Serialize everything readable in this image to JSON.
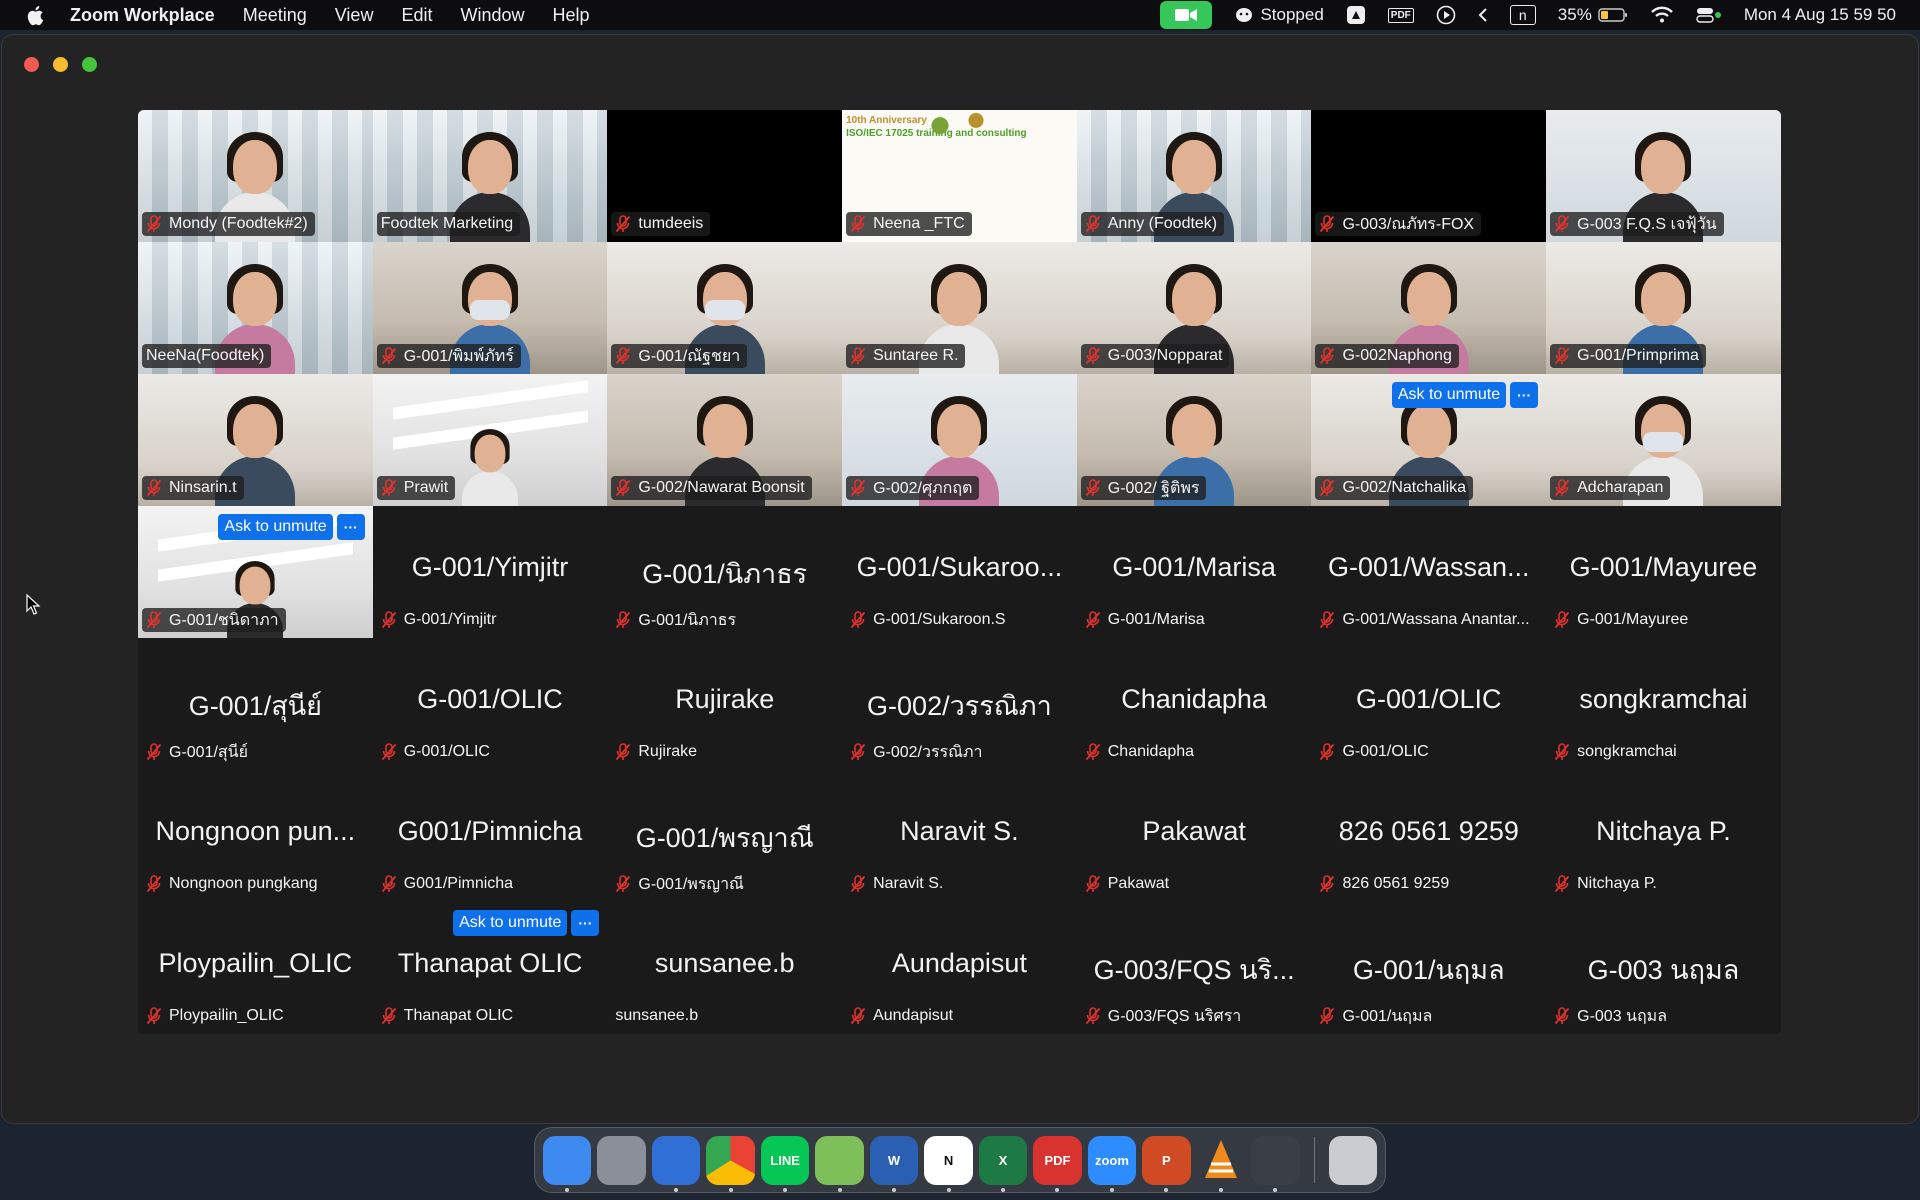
{
  "menubar": {
    "app_name": "Zoom Workplace",
    "items": [
      "Meeting",
      "View",
      "Edit",
      "Window",
      "Help"
    ],
    "status_text": "Stopped",
    "battery": "35%",
    "datetime": "Mon 4 Aug  15 59 50",
    "pdf_label": "PDF",
    "n_label": "n"
  },
  "gallery": {
    "ask_to_unmute_label": "Ask to unmute",
    "more_label": "···",
    "slide_text_1": "10th Anniversary",
    "slide_text_2": "ISO/IEC 17025 training and consulting",
    "tiles": [
      {
        "name": "Mondy (Foodtek#2)",
        "kind": "video",
        "scene": "office",
        "muted": true
      },
      {
        "name": "Foodtek Marketing",
        "kind": "video",
        "scene": "office",
        "muted": false,
        "speaking": true
      },
      {
        "name": "tumdeeis",
        "kind": "black",
        "muted": true
      },
      {
        "name": "Neena _FTC",
        "kind": "slide",
        "muted": true
      },
      {
        "name": "Anny (Foodtek)",
        "kind": "video",
        "scene": "office",
        "muted": true
      },
      {
        "name": "G-003/ณภัทร-FOX",
        "kind": "black",
        "muted": true
      },
      {
        "name": "G-003 F.Q.S เจฟุ้วัน",
        "kind": "video",
        "scene": "blue-bg",
        "muted": true
      },
      {
        "name": "NeeNa(Foodtek)",
        "kind": "video",
        "scene": "office",
        "muted": false
      },
      {
        "name": "G-001/พิมพ์ภัทร์",
        "kind": "video",
        "scene": "room",
        "muted": true,
        "mask": true
      },
      {
        "name": "G-001/ณัฐชยา",
        "kind": "video",
        "scene": "room2",
        "muted": true,
        "mask": true
      },
      {
        "name": "Suntaree R.",
        "kind": "video",
        "scene": "room2",
        "muted": true
      },
      {
        "name": "G-003/Nopparat",
        "kind": "video",
        "scene": "room2",
        "muted": true
      },
      {
        "name": "G-002Naphong",
        "kind": "video",
        "scene": "room",
        "muted": true
      },
      {
        "name": "G-001/Primprima",
        "kind": "video",
        "scene": "room2",
        "muted": true
      },
      {
        "name": "Ninsarin.t",
        "kind": "video",
        "scene": "room2",
        "muted": true
      },
      {
        "name": "Prawit",
        "kind": "video",
        "scene": "ceiling",
        "muted": true
      },
      {
        "name": "G-002/Nawarat Boonsit",
        "kind": "video",
        "scene": "room",
        "muted": true
      },
      {
        "name": "G-002/ศุภกฤต",
        "kind": "video",
        "scene": "blue-bg",
        "muted": true
      },
      {
        "name": "G-002/ ฐิติพร",
        "kind": "video",
        "scene": "room",
        "muted": true
      },
      {
        "name": "G-002/Natchalika",
        "kind": "video",
        "scene": "room2",
        "muted": true,
        "ask": true
      },
      {
        "name": "Adcharapan",
        "kind": "video",
        "scene": "room2",
        "muted": true,
        "mask": true
      },
      {
        "name": "G-001/ชนิดาภา",
        "kind": "video",
        "scene": "ceiling",
        "muted": true,
        "ask": true
      },
      {
        "name": "G-001/Yimjitr",
        "display": "G-001/Yimjitr",
        "kind": "avatar",
        "muted": true
      },
      {
        "name": "G-001/นิภาธร",
        "display": "G-001/นิภาธร",
        "kind": "avatar",
        "muted": true
      },
      {
        "name": "G-001/Sukaroon.S",
        "display": "G-001/Sukaroo...",
        "kind": "avatar",
        "muted": true
      },
      {
        "name": "G-001/Marisa",
        "display": "G-001/Marisa",
        "kind": "avatar",
        "muted": true
      },
      {
        "name": "G-001/Wassana Anantar...",
        "display": "G-001/Wassan...",
        "kind": "avatar",
        "muted": true
      },
      {
        "name": "G-001/Mayuree",
        "display": "G-001/Mayuree",
        "kind": "avatar",
        "muted": true
      },
      {
        "name": "G-001/สุนีย์",
        "display": "G-001/สุนีย์",
        "kind": "avatar",
        "muted": true
      },
      {
        "name": "G-001/OLIC",
        "display": "G-001/OLIC",
        "kind": "avatar",
        "muted": true
      },
      {
        "name": "Rujirake",
        "display": "Rujirake",
        "kind": "avatar",
        "muted": true
      },
      {
        "name": "G-002/วรรณิภา",
        "display": "G-002/วรรณิภา",
        "kind": "avatar",
        "muted": true
      },
      {
        "name": "Chanidapha",
        "display": "Chanidapha",
        "kind": "avatar",
        "muted": true
      },
      {
        "name": "G-001/OLIC",
        "display": "G-001/OLIC",
        "kind": "avatar",
        "muted": true
      },
      {
        "name": "songkramchai",
        "display": "songkramchai",
        "kind": "avatar",
        "muted": true
      },
      {
        "name": "Nongnoon pungkang",
        "display": "Nongnoon pun...",
        "kind": "avatar",
        "muted": true
      },
      {
        "name": "G001/Pimnicha",
        "display": "G001/Pimnicha",
        "kind": "avatar",
        "muted": true
      },
      {
        "name": "G-001/พรญาณี",
        "display": "G-001/พรญาณี",
        "kind": "avatar",
        "muted": true
      },
      {
        "name": "Naravit S.",
        "display": "Naravit S.",
        "kind": "avatar",
        "muted": true
      },
      {
        "name": "Pakawat",
        "display": "Pakawat",
        "kind": "avatar",
        "muted": true
      },
      {
        "name": "826 0561 9259",
        "display": "826 0561 9259",
        "kind": "avatar",
        "muted": true
      },
      {
        "name": "Nitchaya P.",
        "display": "Nitchaya P.",
        "kind": "avatar",
        "muted": true
      },
      {
        "name": "Ploypailin_OLIC",
        "display": "Ploypailin_OLIC",
        "kind": "avatar",
        "muted": true
      },
      {
        "name": "Thanapat OLIC",
        "display": "Thanapat OLIC",
        "kind": "avatar",
        "muted": true,
        "ask": true
      },
      {
        "name": "sunsanee.b",
        "display": "sunsanee.b",
        "kind": "avatar",
        "muted": false
      },
      {
        "name": "Aundapisut",
        "display": "Aundapisut",
        "kind": "avatar",
        "muted": true
      },
      {
        "name": "G-003/FQS นริศรา",
        "display": "G-003/FQS นริ...",
        "kind": "avatar",
        "muted": true
      },
      {
        "name": "G-001/นฤมล",
        "display": "G-001/นฤมล",
        "kind": "avatar",
        "muted": true
      },
      {
        "name": "G-003 นฤมล",
        "display": "G-003 นฤมล",
        "kind": "avatar",
        "muted": true
      }
    ]
  },
  "dock": {
    "apps": [
      {
        "name": "finder",
        "label": "",
        "color": "#3d8bf0"
      },
      {
        "name": "launchpad",
        "label": "",
        "color": "#8a8f99"
      },
      {
        "name": "thunderbird",
        "label": "",
        "color": "#2f6fd6"
      },
      {
        "name": "chrome",
        "label": "",
        "color": "#e8e8e8"
      },
      {
        "name": "line",
        "label": "LINE",
        "color": "#06c755"
      },
      {
        "name": "maps",
        "label": "",
        "color": "#7fbf5a"
      },
      {
        "name": "word",
        "label": "W",
        "color": "#2b5fb4"
      },
      {
        "name": "notion",
        "label": "N",
        "color": "#ffffff"
      },
      {
        "name": "excel",
        "label": "X",
        "color": "#1e7a45"
      },
      {
        "name": "pdf-expert",
        "label": "PDF",
        "color": "#d9332f"
      },
      {
        "name": "zoom",
        "label": "zoom",
        "color": "#2d8cff"
      },
      {
        "name": "powerpoint",
        "label": "P",
        "color": "#d04a24"
      },
      {
        "name": "vlc",
        "label": "",
        "color": "#f08a1c"
      },
      {
        "name": "quicktime",
        "label": "",
        "color": "#3a3f47"
      },
      {
        "name": "trash",
        "label": "",
        "color": "#c9ccd1"
      }
    ]
  }
}
